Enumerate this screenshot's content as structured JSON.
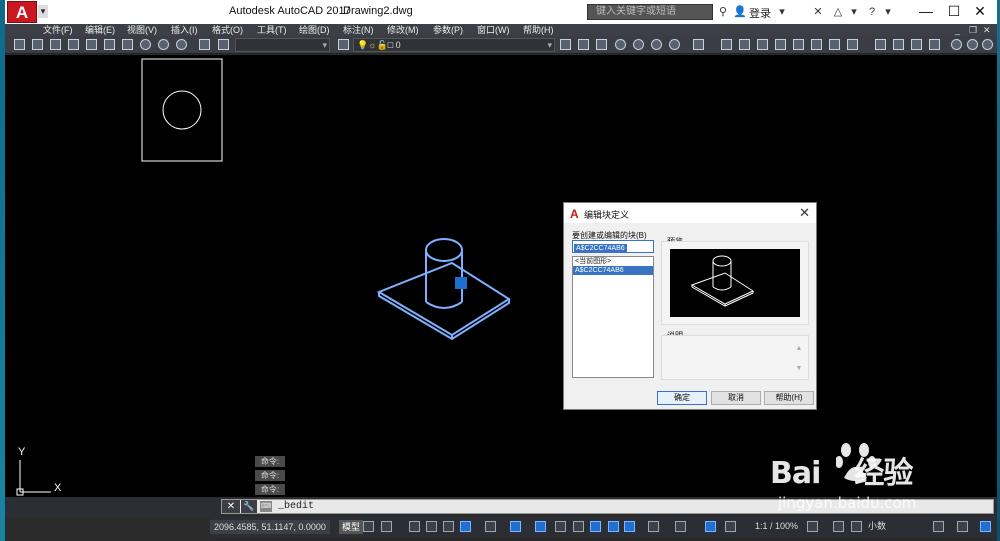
{
  "app": {
    "logo": "A",
    "title": "Autodesk AutoCAD 2017",
    "document": "Drawing2.dwg",
    "search_placeholder": "键入关键字或短语",
    "login": "登录"
  },
  "menu": [
    {
      "label": "文件(F)"
    },
    {
      "label": "编辑(E)"
    },
    {
      "label": "视图(V)"
    },
    {
      "label": "插入(I)"
    },
    {
      "label": "格式(O)"
    },
    {
      "label": "工具(T)"
    },
    {
      "label": "绘图(D)"
    },
    {
      "label": "标注(N)"
    },
    {
      "label": "修改(M)"
    },
    {
      "label": "参数(P)"
    },
    {
      "label": "窗口(W)"
    },
    {
      "label": "帮助(H)"
    }
  ],
  "toolbar": {
    "layer_value": "0"
  },
  "command": {
    "history": [
      "命令:",
      "命令:",
      "命令:"
    ],
    "current": "_bedit"
  },
  "status": {
    "coords": "2096.4585, 51.1147, 0.0000",
    "model": "模型",
    "scale": "1:1 / 100%",
    "units": "小数"
  },
  "dialog": {
    "title": "编辑块定义",
    "block_label": "要创建或编辑的块(B)",
    "block_value": "A$C2CC74AB6",
    "list_items": [
      "<当前图形>",
      "A$C2CC74AB6"
    ],
    "preview_label": "预览",
    "description_label": "说明",
    "ok": "确定",
    "cancel": "取消",
    "help": "帮助(H)"
  },
  "ucs": {
    "y": "Y",
    "x": "X"
  },
  "watermark": {
    "brand": "Bai",
    "suffix": "经验",
    "url": "jingyan.baidu.com"
  },
  "colors": {
    "accent": "#3a72c4",
    "brand_red": "#c9181e",
    "selection_blue": "#1f6fd1"
  }
}
